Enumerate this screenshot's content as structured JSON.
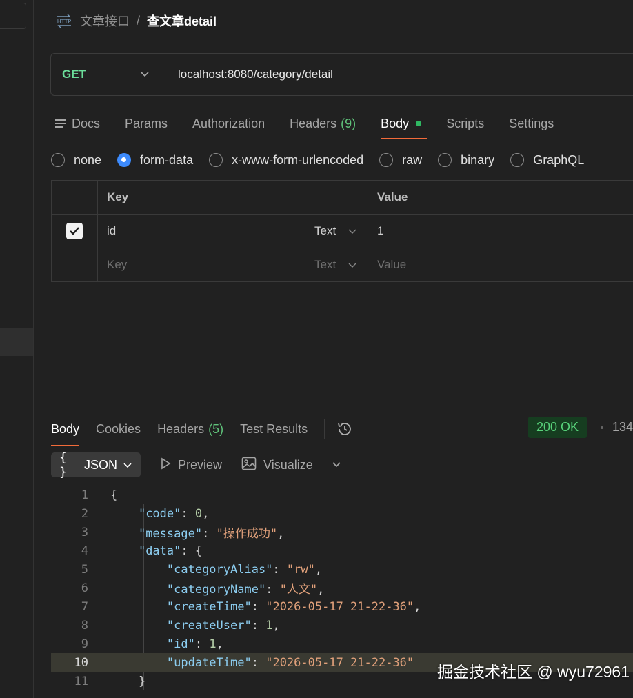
{
  "breadcrumb": {
    "parent": "文章接口",
    "separator": "/",
    "current": "查文章detail"
  },
  "request": {
    "method": "GET",
    "url": "localhost:8080/category/detail"
  },
  "request_tabs": [
    {
      "label": "Docs"
    },
    {
      "label": "Params"
    },
    {
      "label": "Authorization"
    },
    {
      "label": "Headers",
      "count": "(9)"
    },
    {
      "label": "Body"
    },
    {
      "label": "Scripts"
    },
    {
      "label": "Settings"
    }
  ],
  "body_types": [
    "none",
    "form-data",
    "x-www-form-urlencoded",
    "raw",
    "binary",
    "GraphQL"
  ],
  "body_type_selected": "form-data",
  "params_table": {
    "headers": {
      "key": "Key",
      "value": "Value"
    },
    "rows": [
      {
        "checked": true,
        "key": "id",
        "type": "Text",
        "value": "1"
      }
    ],
    "placeholder": {
      "key": "Key",
      "type": "Text",
      "value": "Value"
    }
  },
  "response_tabs": [
    {
      "label": "Body"
    },
    {
      "label": "Cookies"
    },
    {
      "label": "Headers",
      "count": "(5)"
    },
    {
      "label": "Test Results"
    }
  ],
  "response_status": "200 OK",
  "response_size_partial": "134",
  "view_tools": {
    "format": "JSON",
    "preview": "Preview",
    "visualize": "Visualize"
  },
  "code_lines": [
    {
      "n": "1",
      "t": "{"
    },
    {
      "n": "2",
      "t": "    \"code\": 0,"
    },
    {
      "n": "3",
      "t": "    \"message\": \"操作成功\","
    },
    {
      "n": "4",
      "t": "    \"data\": {"
    },
    {
      "n": "5",
      "t": "        \"categoryAlias\": \"rw\","
    },
    {
      "n": "6",
      "t": "        \"categoryName\": \"人文\","
    },
    {
      "n": "7",
      "t": "        \"createTime\": \"2026-05-17 21-22-36\","
    },
    {
      "n": "8",
      "t": "        \"createUser\": 1,"
    },
    {
      "n": "9",
      "t": "        \"id\": 1,"
    },
    {
      "n": "10",
      "t": "        \"updateTime\": \"2026-05-17 21-22-36\""
    },
    {
      "n": "11",
      "t": "    }"
    }
  ],
  "highlighted_line": "10",
  "watermark": "掘金技术社区 @ wyu72961",
  "colors": {
    "accent": "#f26b3a",
    "method": "#6bdd9a",
    "status_bg": "#163d20",
    "status_fg": "#58d37b",
    "radio_on": "#3d8bfd"
  }
}
